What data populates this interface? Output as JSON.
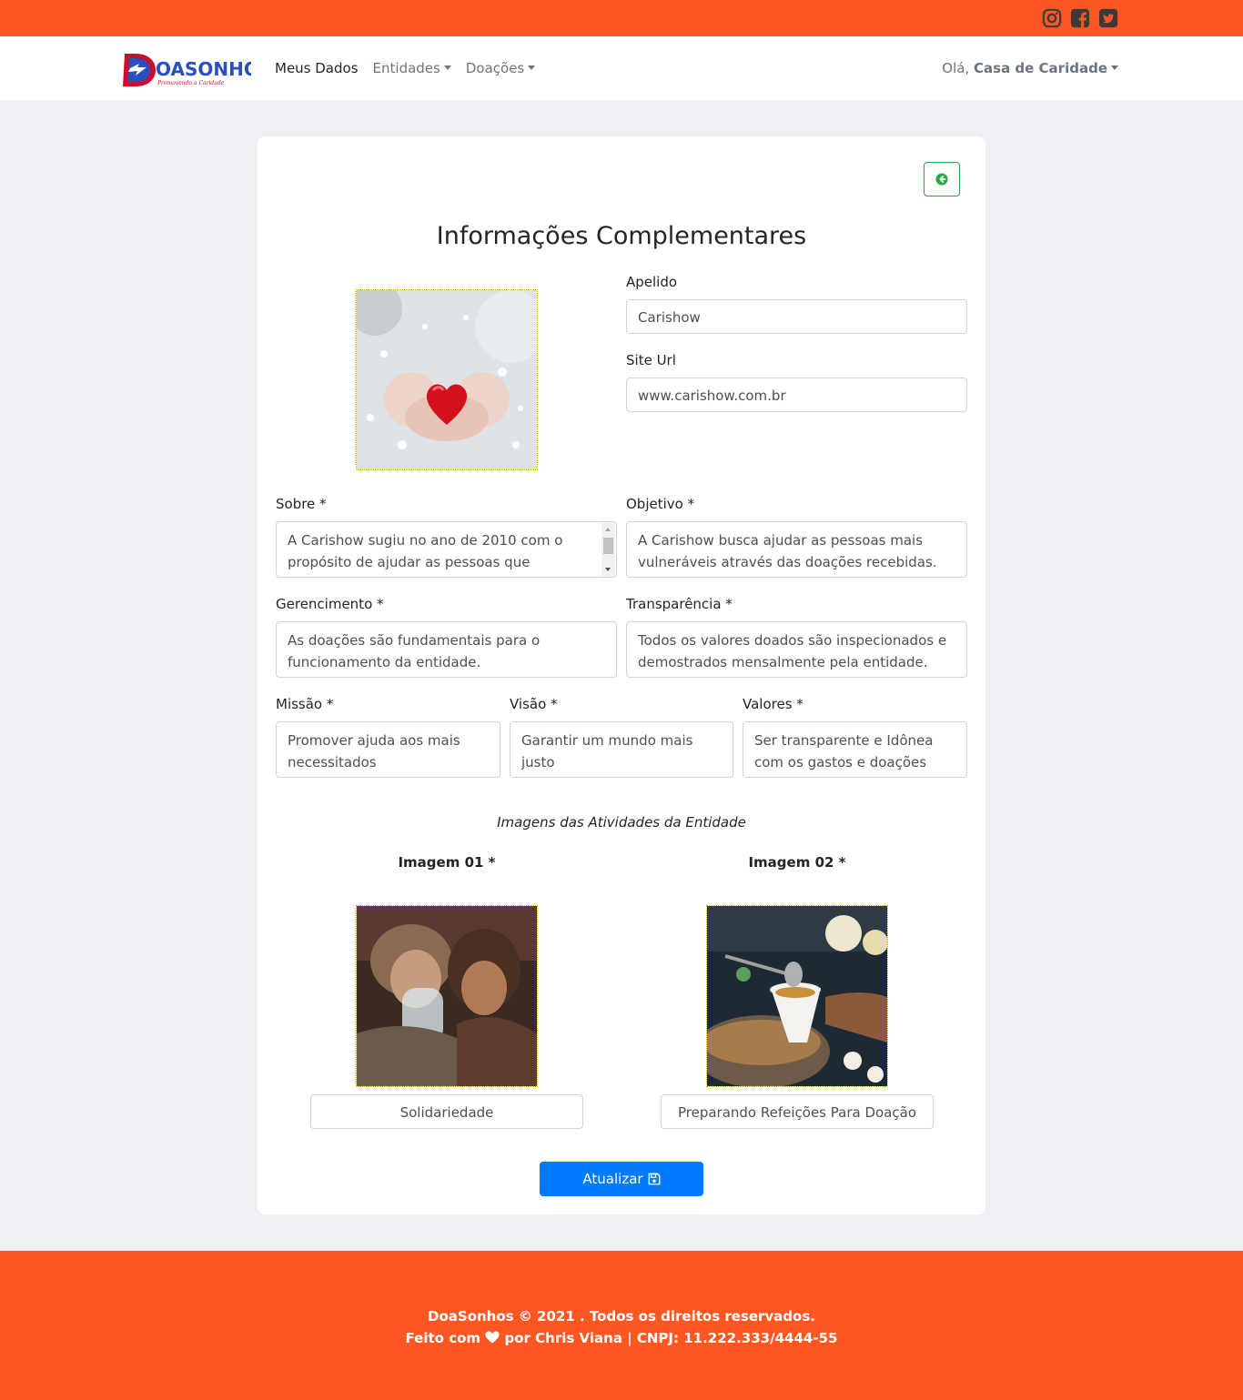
{
  "header": {
    "social": [
      "instagram-icon",
      "facebook-icon",
      "twitter-icon"
    ],
    "brand": {
      "logo_text": "OASONHOS",
      "tagline": "Promovendo a Caridade"
    },
    "nav": [
      {
        "label": "Meus Dados",
        "dropdown": false,
        "active": true
      },
      {
        "label": "Entidades",
        "dropdown": true,
        "active": false
      },
      {
        "label": "Doações",
        "dropdown": true,
        "active": false
      }
    ],
    "greeting": "Olá,",
    "user_name": "Casa de Caridade"
  },
  "form": {
    "title": "Informações Complementares",
    "apelido": {
      "label": "Apelido",
      "value": "Carishow"
    },
    "site_url": {
      "label": "Site Url",
      "value": "www.carishow.com.br"
    },
    "sobre": {
      "label": "Sobre *",
      "value": "A Carishow sugiu no ano de 2010 com o propósito de ajudar as pessoas que"
    },
    "objetivo": {
      "label": "Objetivo *",
      "value": "A Carishow busca ajudar as pessoas mais vulneráveis através das doações recebidas."
    },
    "gerenciamento": {
      "label": "Gerencimento *",
      "value": "As doações são fundamentais para o funcionamento da entidade."
    },
    "transparencia": {
      "label": "Transparência *",
      "value": "Todos os valores doados são inspecionados e demostrados mensalmente pela entidade."
    },
    "missao": {
      "label": "Missão *",
      "value": "Promover ajuda aos mais necessitados"
    },
    "visao": {
      "label": "Visão *",
      "value": "Garantir um mundo mais justo"
    },
    "valores": {
      "label": "Valores *",
      "value": "Ser transparente e Idônea com os gastos e doações recebidas"
    },
    "images_caption": "Imagens das Atividades da Entidade",
    "images": [
      {
        "title": "Imagem 01 *",
        "caption": "Solidariedade"
      },
      {
        "title": "Imagem 02 *",
        "caption": "Preparando Refeições Para Doação"
      }
    ],
    "submit_label": "Atualizar"
  },
  "footer": {
    "line1": "DoaSonhos © 2021 . Todos os direitos reservados.",
    "line2_prefix": "Feito com",
    "line2_suffix": "por Chris Viana | CNPJ: 11.222.333/4444-55"
  },
  "colors": {
    "brand_orange": "#ff5722",
    "primary": "#007bff",
    "success": "#28a745",
    "page_bg": "#eef0f4"
  }
}
